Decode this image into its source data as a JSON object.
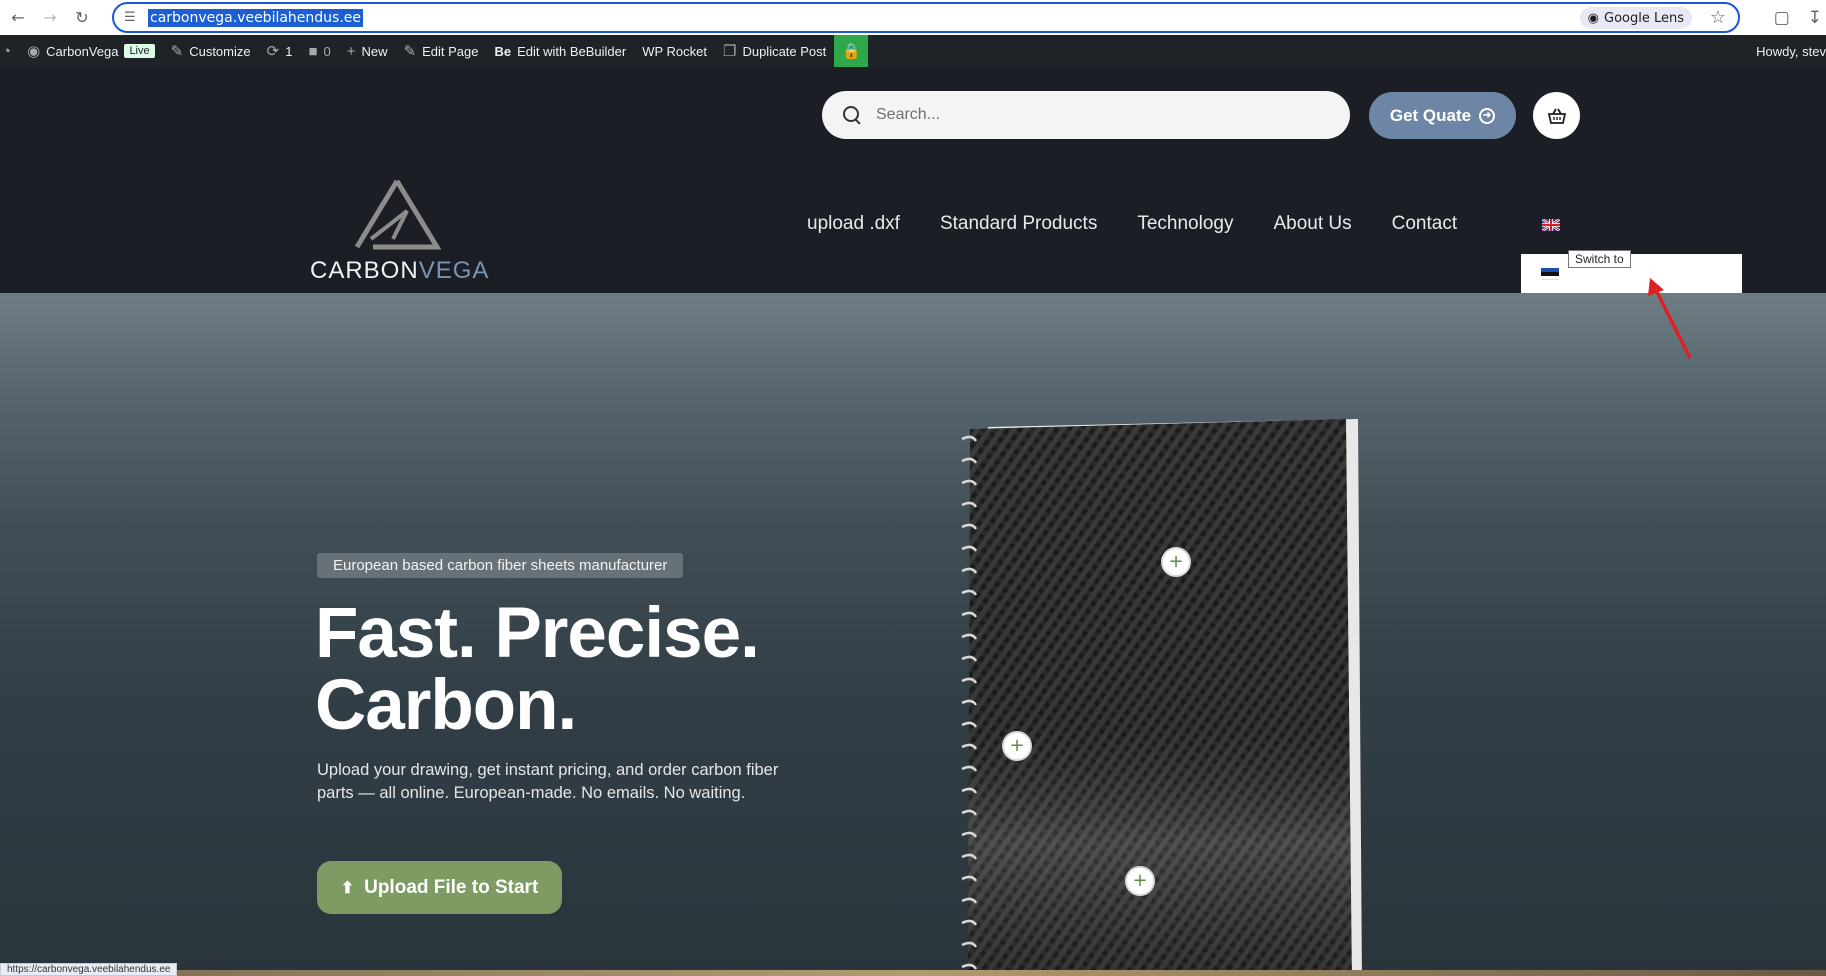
{
  "browser": {
    "url": "carbonvega.veebilahendus.ee",
    "lens_label": "Google Lens",
    "status_url": "https://carbonvega.veebilahendus.ee"
  },
  "admin_bar": {
    "site_name": "CarbonVega",
    "live_badge": "Live",
    "customize": "Customize",
    "updates_count": "1",
    "comments_count": "0",
    "new": "New",
    "edit_page": "Edit Page",
    "edit_bebuilder": "Edit with BeBuilder",
    "be_mark": "Be",
    "wp_rocket": "WP Rocket",
    "duplicate_post": "Duplicate Post",
    "howdy": "Howdy, stev"
  },
  "header": {
    "search_placeholder": "Search...",
    "quote_label": "Get Quate",
    "logo_carbon": "CARBON",
    "logo_vega": "VEGA",
    "nav": [
      {
        "label": "upload .dxf"
      },
      {
        "label": "Standard Products"
      },
      {
        "label": "Technology"
      },
      {
        "label": "About Us"
      },
      {
        "label": "Contact"
      }
    ]
  },
  "language_dropdown": {
    "tooltip": "Switch to"
  },
  "hero": {
    "tagline": "European based carbon fiber sheets manufacturer",
    "headline_line1": "Fast. Precise.",
    "headline_line2": "Carbon.",
    "body": "Upload your drawing, get instant pricing, and order carbon fiber parts — all online. European-made. No emails. No waiting.",
    "cta": "Upload File to Start"
  },
  "colors": {
    "header_bg": "#1b1f25",
    "accent_blue": "#6e86a6",
    "cta_green": "#7d9b62",
    "admin_bar_bg": "#1d2327"
  }
}
